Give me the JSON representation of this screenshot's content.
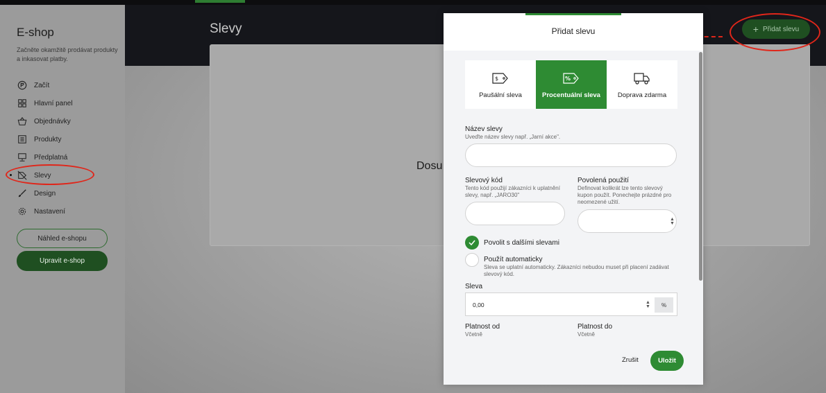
{
  "sidebar": {
    "title": "E-shop",
    "subtitle": "Začněte okamžitě prodávat produkty a inkasovat platby.",
    "items": [
      {
        "label": "Začít",
        "icon": "rocket-icon"
      },
      {
        "label": "Hlavní panel",
        "icon": "dashboard-icon"
      },
      {
        "label": "Objednávky",
        "icon": "basket-icon"
      },
      {
        "label": "Produkty",
        "icon": "list-icon"
      },
      {
        "label": "Předplatná",
        "icon": "monitor-icon"
      },
      {
        "label": "Slevy",
        "icon": "tag-off-icon",
        "active": true
      },
      {
        "label": "Design",
        "icon": "brush-icon"
      },
      {
        "label": "Nastavení",
        "icon": "gear-icon"
      }
    ],
    "preview_button": "Náhled e-shopu",
    "edit_button": "Upravit e-shop"
  },
  "header": {
    "title": "Slevy",
    "add_button": "Přidat slevu"
  },
  "main": {
    "empty_text": "Dosu"
  },
  "modal": {
    "title": "Přidat slevu",
    "tabs": [
      {
        "label": "Paušální sleva",
        "icon": "dollar-tag-icon"
      },
      {
        "label": "Procentuální sleva",
        "icon": "percent-tag-icon",
        "active": true
      },
      {
        "label": "Doprava zdarma",
        "icon": "truck-icon"
      }
    ],
    "name_label": "Název slevy",
    "name_hint": "Uveďte název slevy např. „Jarní akce\".",
    "name_value": "",
    "code_label": "Slevový kód",
    "code_hint": "Tento kód použijí zákazníci k uplatnění slevy, např. „JARO30\"",
    "code_value": "",
    "uses_label": "Povolená použití",
    "uses_hint": "Definovat kolikrát lze tento slevový kupon použít. Ponechejte prázdné pro neomezené užití.",
    "uses_value": "",
    "combine_label": "Povolit s dalšími slevami",
    "combine_checked": true,
    "auto_label": "Použít automaticky",
    "auto_hint": "Sleva se uplatní automaticky. Zákazníci nebudou muset při placení zadávat slevový kód.",
    "auto_checked": false,
    "discount_label": "Sleva",
    "discount_value": "0,00",
    "discount_unit": "%",
    "valid_from_label": "Platnost od",
    "valid_from_hint": "Včetně",
    "valid_to_label": "Platnost do",
    "valid_to_hint": "Včetně",
    "cancel_button": "Zrušit",
    "save_button": "Uložit"
  },
  "colors": {
    "accent": "#2e8b33",
    "header_bg": "#15161b",
    "annotation": "#e0261a"
  }
}
